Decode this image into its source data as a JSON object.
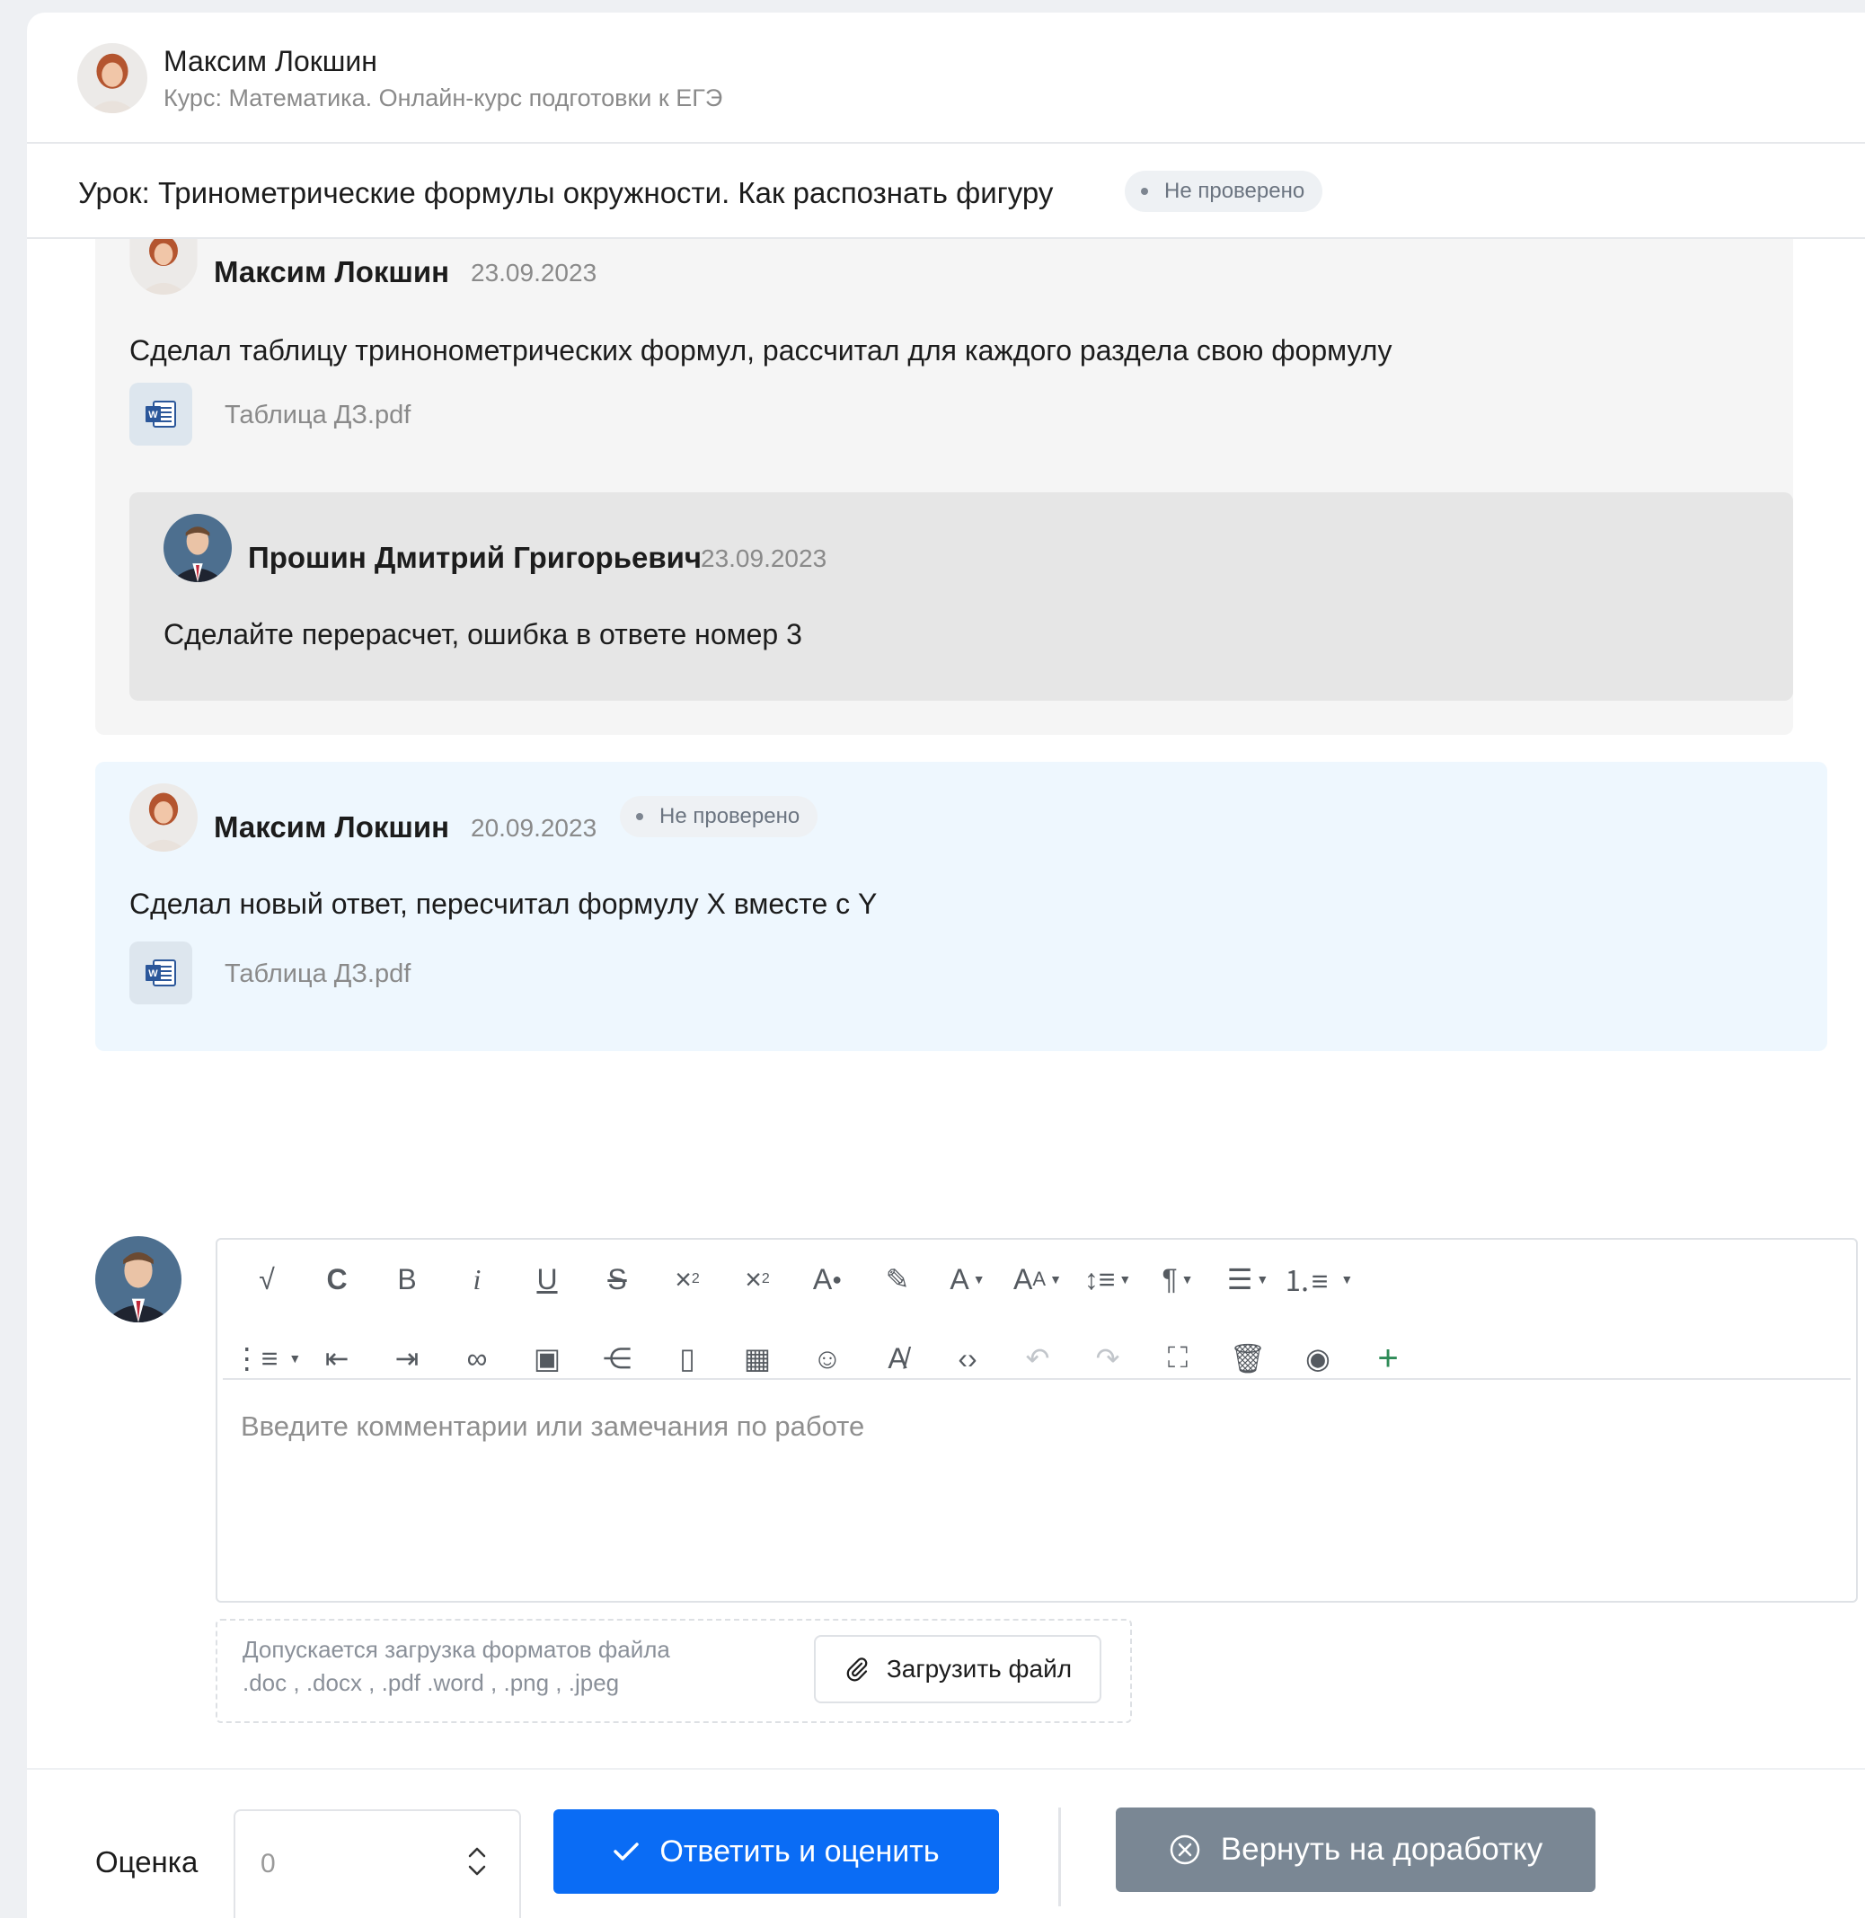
{
  "header": {
    "student_name": "Максим Локшин",
    "course": "Курс: Математика. Онлайн-курс подготовки к ЕГЭ"
  },
  "lesson": {
    "title": "Урок: Тринометрические формулы окружности. Как распознать фигуру",
    "status": "Не проверено"
  },
  "thread1": {
    "author": "Максим Локшин",
    "date": "23.09.2023",
    "message": "Сделал таблицу тринонометрических формул, рассчитал для каждого раздела свою формулу",
    "file": "Таблица ДЗ.pdf",
    "reply": {
      "author": "Прошин Дмитрий  Григорьевич",
      "date": "23.09.2023",
      "message": "Сделайте перерасчет, ошибка в ответе номер 3"
    }
  },
  "thread2": {
    "author": "Максим Локшин",
    "date": "20.09.2023",
    "status": "Не проверено",
    "message": "Сделал новый ответ, пересчитал формулу X вместе с Y",
    "file": "Таблица ДЗ.pdf"
  },
  "editor": {
    "placeholder": "Введите комментарии или замечания по работе",
    "toolbar_row1": [
      "check-icon",
      "clear-format-icon",
      "bold-icon",
      "italic-icon",
      "underline-icon",
      "strikethrough-icon",
      "subscript-icon",
      "superscript-icon",
      "text-color-icon",
      "highlight-icon",
      "font-family-icon",
      "font-size-icon",
      "line-height-icon",
      "paragraph-icon",
      "align-icon",
      "ordered-list-icon"
    ],
    "toolbar_row2": [
      "bullet-list-icon",
      "outdent-icon",
      "indent-icon",
      "link-icon",
      "image-icon",
      "share-icon",
      "file-icon",
      "table-icon",
      "emoji-icon",
      "clear-text-icon",
      "code-icon",
      "undo-icon",
      "redo-icon",
      "fullscreen-icon",
      "delete-icon",
      "preview-icon",
      "add-icon"
    ]
  },
  "upload": {
    "hint_line1": "Допускается загрузка форматов файла",
    "hint_line2": ".doc , .docx , .pdf .word , .png , .jpeg",
    "button": "Загрузить файл"
  },
  "footer": {
    "grade_label": "Оценка",
    "grade_value": "0",
    "submit_button": "Ответить и оценить",
    "return_button": "Вернуть на доработку"
  },
  "colors": {
    "primary": "#0a6cf5",
    "secondary": "#7a8794",
    "thread_bg": "#f5f5f5",
    "reply_bg": "#e6e6e6",
    "new_answer_bg": "#eef7fe",
    "add_icon": "#2e8b57"
  }
}
